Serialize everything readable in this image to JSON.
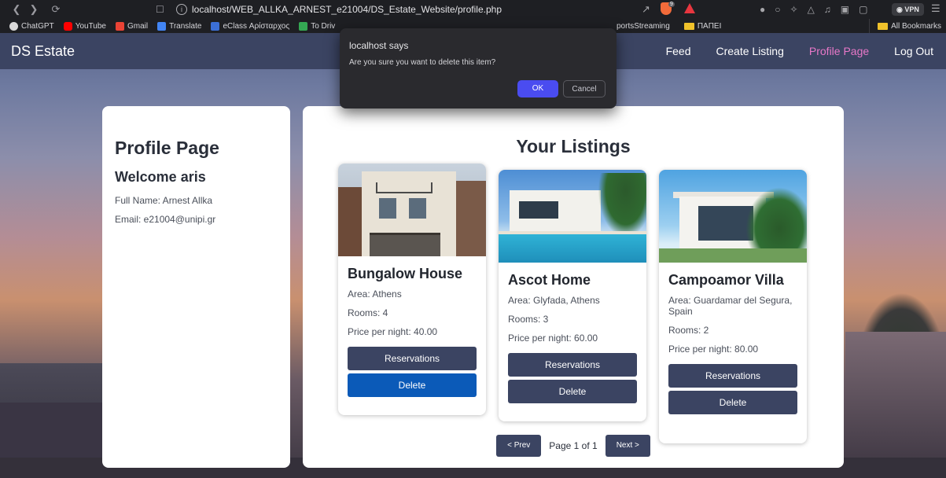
{
  "browser": {
    "url": "localhost/WEB_ALLKA_ARNEST_e21004/DS_Estate_Website/profile.php",
    "vpn_label": "VPN",
    "brave_badge": "9",
    "bookmarks": [
      {
        "label": "ChatGPT",
        "icon": "chatgpt-icon",
        "color": "#d9d9d9"
      },
      {
        "label": "YouTube",
        "icon": "youtube-icon",
        "color": "#ff0000"
      },
      {
        "label": "Gmail",
        "icon": "gmail-icon",
        "color": "#ea4335"
      },
      {
        "label": "Translate",
        "icon": "translate-icon",
        "color": "#4285f4"
      },
      {
        "label": "eClass Αρίσταρχος",
        "icon": "eclass-icon",
        "color": "#3b6fd6"
      },
      {
        "label": "To Driv",
        "icon": "drive-icon",
        "color": "#34a853"
      }
    ],
    "bookmarks_right": [
      {
        "label": "portsStreaming"
      },
      {
        "label": "ΠΑΠΕΙ",
        "icon": "folder-icon"
      }
    ],
    "all_bookmarks": "All Bookmarks"
  },
  "navbar": {
    "brand": "DS Estate",
    "links": [
      {
        "label": "Feed",
        "active": false
      },
      {
        "label": "Create Listing",
        "active": false
      },
      {
        "label": "Profile Page",
        "active": true
      },
      {
        "label": "Log Out",
        "active": false
      }
    ]
  },
  "profile": {
    "title": "Profile Page",
    "welcome": "Welcome aris",
    "full_name": "Full Name: Arnest Allka",
    "email": "Email: e21004@unipi.gr"
  },
  "listings": {
    "title": "Your Listings",
    "items": [
      {
        "title": "Bungalow House",
        "area": "Area: Athens",
        "rooms": "Rooms: 4",
        "price": "Price per night: 40.00",
        "reserve_label": "Reservations",
        "delete_label": "Delete"
      },
      {
        "title": "Ascot Home",
        "area": "Area: Glyfada, Athens",
        "rooms": "Rooms: 3",
        "price": "Price per night: 60.00",
        "reserve_label": "Reservations",
        "delete_label": "Delete"
      },
      {
        "title": "Campoamor Villa",
        "area": "Area: Guardamar del Segura, Spain",
        "rooms": "Rooms: 2",
        "price": "Price per night: 80.00",
        "reserve_label": "Reservations",
        "delete_label": "Delete"
      }
    ],
    "pagination": {
      "prev": "< Prev",
      "status": "Page 1 of 1",
      "next": "Next >"
    }
  },
  "dialog": {
    "title": "localhost says",
    "message": "Are you sure you want to delete this item?",
    "ok": "OK",
    "cancel": "Cancel"
  },
  "colors": {
    "navbar_bg": "#3b4462",
    "active_link": "#e878c8",
    "button_bg": "#3b4462",
    "delete_hover": "#0b5ab8",
    "dialog_ok": "#4a4cf0"
  }
}
